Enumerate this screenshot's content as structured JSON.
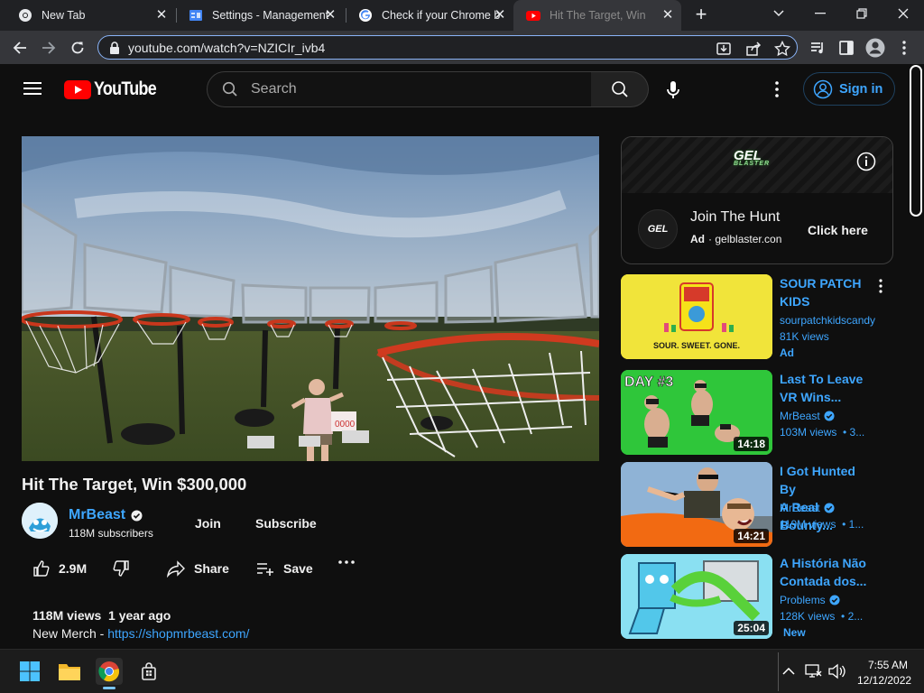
{
  "browser": {
    "tabs": [
      {
        "title": "New Tab",
        "icon": "chrome-icon"
      },
      {
        "title": "Settings - Management",
        "icon": "settings-doc-icon"
      },
      {
        "title": "Check if your Chrome b",
        "icon": "google-icon"
      },
      {
        "title": "Hit The Target, Win",
        "icon": "youtube-icon",
        "active": true
      }
    ],
    "url": "youtube.com/watch?v=NZICIr_ivb4"
  },
  "youtube": {
    "logo_text": "YouTube",
    "search_placeholder": "Search",
    "signin_label": "Sign in",
    "video": {
      "title": "Hit The Target, Win $300,000",
      "channel": "MrBeast",
      "subscribers": "118M subscribers",
      "join_label": "Join",
      "subscribe_label": "Subscribe",
      "likes": "2.9M",
      "share_label": "Share",
      "save_label": "Save",
      "views_date": "118M views  1 year ago",
      "desc_prefix": "New Merch - ",
      "desc_link": "https://shopmrbeast.com/"
    },
    "ad": {
      "brand_logo": "GEL BLASTER",
      "title": "Join The Hunt",
      "badge": "Ad",
      "domain": "gelblaster.con",
      "cta": "Click here"
    },
    "recommendations": [
      {
        "title_line1": "SOUR PATCH",
        "title_line2": "KIDS",
        "channel": "sourpatchkidscandy",
        "views": "81K views",
        "badge": "Ad",
        "thumb_text": "SOUR. SWEET. GONE.",
        "verified": false
      },
      {
        "title_line1": "Last To Leave",
        "title_line2": "VR Wins...",
        "channel": "MrBeast",
        "views": "103M views  • 3...",
        "duration": "14:18",
        "thumb_text": "DAY #3",
        "verified": true
      },
      {
        "title_line1": "I Got Hunted By",
        "title_line2": "A Real Bounty...",
        "channel": "MrBeast",
        "views": "119M views  • 1...",
        "duration": "14:21",
        "verified": true
      },
      {
        "title_line1": "A História Não",
        "title_line2": "Contada dos...",
        "channel": "Problems",
        "views": "128K views  • 2...",
        "duration": "25:04",
        "badge": "New",
        "verified": true
      }
    ]
  },
  "taskbar": {
    "time": "7:55 AM",
    "date": "12/12/2022"
  },
  "colors": {
    "yt_bg": "#0f0f0f",
    "link_blue": "#3ea6ff",
    "youtube_red": "#ff0000",
    "chrome_tabbar": "#202124",
    "chrome_toolbar": "#35363a"
  }
}
